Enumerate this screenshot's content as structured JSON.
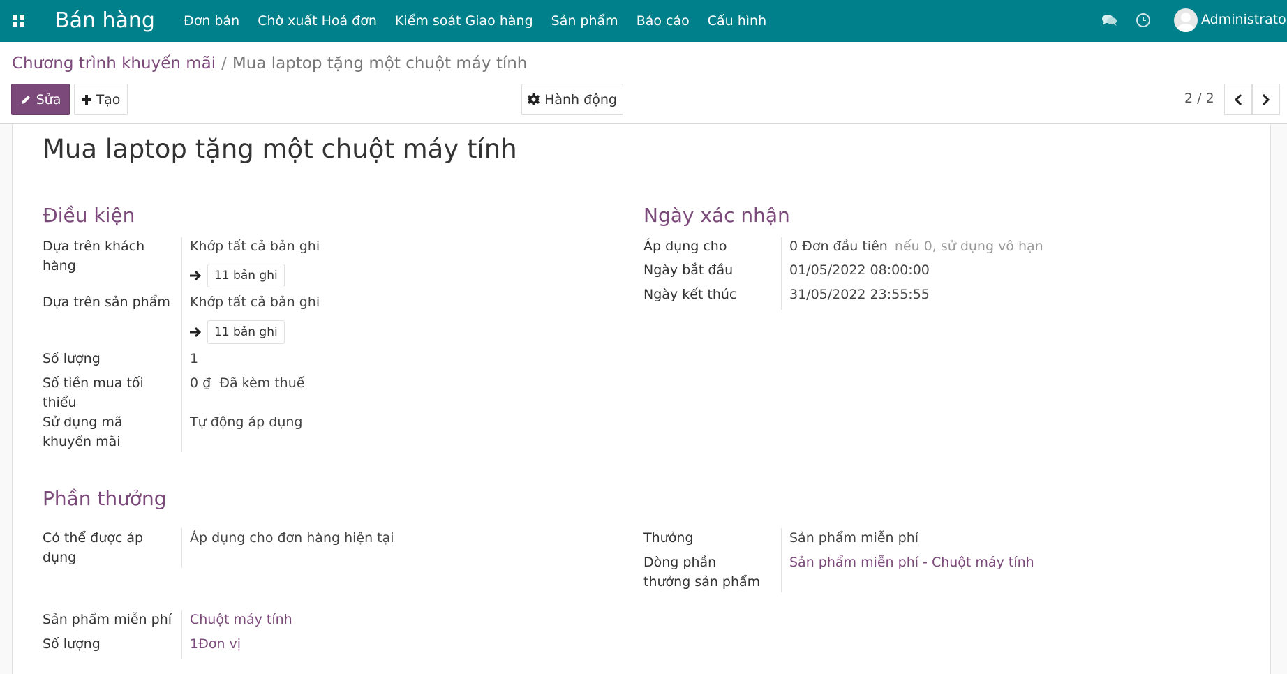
{
  "navbar": {
    "brand": "Bán hàng",
    "menu": [
      "Đơn bán",
      "Chờ xuất Hoá đơn",
      "Kiểm soát Giao hàng",
      "Sản phẩm",
      "Báo cáo",
      "Cấu hình"
    ],
    "user": "Administrator",
    "icons": [
      "apps-grid-icon",
      "chat-icon",
      "clock-icon",
      "avatar"
    ]
  },
  "breadcrumb": {
    "parent": "Chương trình khuyến mãi",
    "separator": "/",
    "current": "Mua laptop tặng một chuột máy tính"
  },
  "toolbar": {
    "edit": "Sửa",
    "create": "Tạo",
    "action": "Hành động",
    "pager": "2 / 2"
  },
  "record": {
    "title": "Mua laptop tặng một chuột máy tính",
    "conditions": {
      "heading": "Điều kiện",
      "customer_label": "Dựa trên khách hàng",
      "customer_value": "Khớp tất cả bản ghi",
      "customer_records": "11 bản ghi",
      "product_label": "Dựa trên sản phẩm",
      "product_value": "Khớp tất cả bản ghi",
      "product_records": "11 bản ghi",
      "quantity_label": "Số lượng",
      "quantity_value": "1",
      "min_amount_label": "Số tiền mua tối thiểu",
      "min_amount_value": "0 ₫",
      "min_amount_tax": "Đã kèm thuế",
      "code_label": "Sử dụng mã khuyến mãi",
      "code_value": "Tự động áp dụng"
    },
    "validity": {
      "heading": "Ngày xác nhận",
      "apply_label": "Áp dụng cho",
      "apply_value": "0 Đơn đầu tiên",
      "apply_hint": "nếu 0, sử dụng vô hạn",
      "start_label": "Ngày bắt đầu",
      "start_value": "01/05/2022 08:00:00",
      "end_label": "Ngày kết thúc",
      "end_value": "31/05/2022 23:55:55"
    },
    "rewards": {
      "heading": "Phần thưởng",
      "applicable_label": "Có thể được áp dụng",
      "applicable_value": "Áp dụng cho đơn hàng hiện tại",
      "reward_label": "Thưởng",
      "reward_value": "Sản phẩm miễn phí",
      "reward_line_label": "Dòng phần thưởng sản phẩm",
      "reward_line_value": "Sản phẩm miễn phí - Chuột máy tính",
      "free_product_label": "Sản phẩm miễn phí",
      "free_product_value": "Chuột máy tính",
      "quantity_label": "Số lượng",
      "quantity_value": "1Đơn vị"
    }
  },
  "colors": {
    "navbar": "#00808a",
    "primary": "#7c4a7a"
  }
}
